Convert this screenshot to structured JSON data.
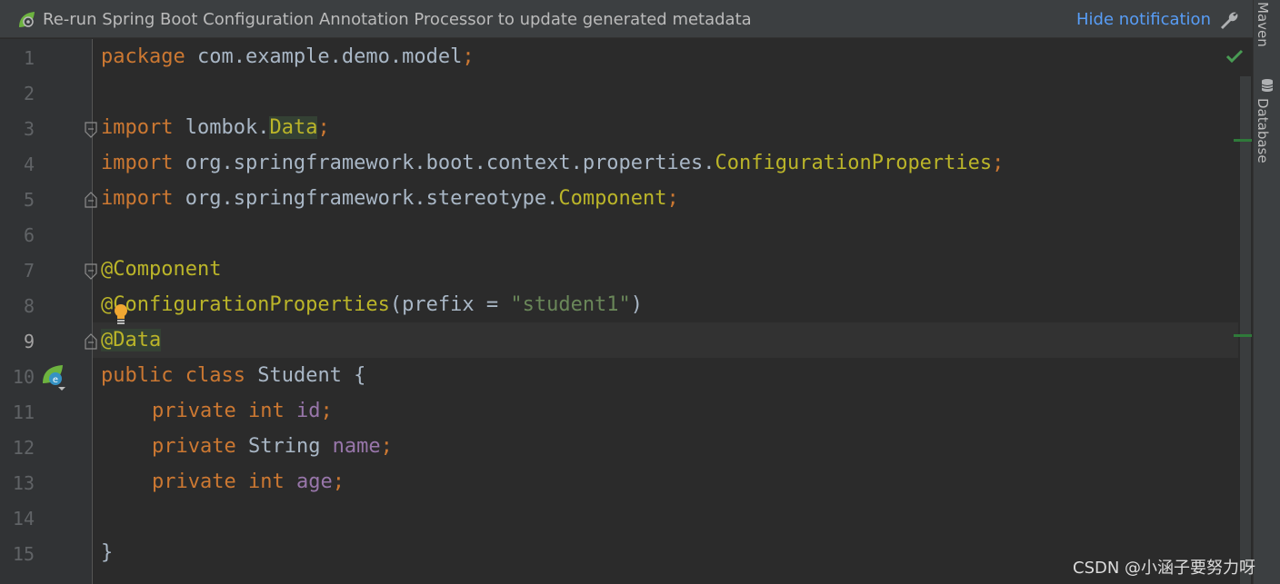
{
  "notification": {
    "message": "Re-run Spring Boot Configuration Annotation Processor to update generated metadata",
    "action": "Hide notification"
  },
  "side_panels": [
    "Maven",
    "Database"
  ],
  "editor": {
    "current_line": 9,
    "line_numbers": [
      "1",
      "2",
      "3",
      "4",
      "5",
      "6",
      "7",
      "8",
      "9",
      "10",
      "11",
      "12",
      "13",
      "14",
      "15"
    ],
    "lines": {
      "l1": {
        "kw": "package",
        "rest": " com.example.demo.model",
        "semi": ";"
      },
      "l3": {
        "kw": "import",
        "pkg": " lombok.",
        "cls": "Data",
        "semi": ";"
      },
      "l4": {
        "kw": "import",
        "pkg": " org.springframework.boot.context.properties.",
        "cls": "ConfigurationProperties",
        "semi": ";"
      },
      "l5": {
        "kw": "import",
        "pkg": " org.springframework.stereotype.",
        "cls": "Component",
        "semi": ";"
      },
      "l7": {
        "ann": "@Component"
      },
      "l8": {
        "ann": "@ConfigurationProperties",
        "open": "(prefix = ",
        "str": "\"student1\"",
        "close": ")"
      },
      "l9": {
        "ann": "@Data"
      },
      "l10": {
        "kw1": "public",
        "kw2": " class",
        "name": " Student {"
      },
      "l11": {
        "kw1": "private",
        "kw2": " int",
        "field": " id",
        "semi": ";"
      },
      "l12": {
        "kw1": "private",
        "type": " String",
        "field": " name",
        "semi": ";"
      },
      "l13": {
        "kw1": "private",
        "kw2": " int",
        "field": " age",
        "semi": ";"
      },
      "l15": {
        "text": "}"
      }
    }
  },
  "watermark": "CSDN @小涵子要努力呀",
  "colors": {
    "editor_bg": "#2b2b2b",
    "gutter_bg": "#313335",
    "keyword": "#cc7832",
    "annotation": "#bbb529",
    "string": "#6a8759",
    "field": "#9876aa",
    "link": "#589df6"
  },
  "icons": [
    "spring-leaf-icon",
    "wrench-icon",
    "check-icon",
    "fold-icon",
    "lightbulb-icon",
    "spring-bean-icon",
    "database-icon"
  ]
}
